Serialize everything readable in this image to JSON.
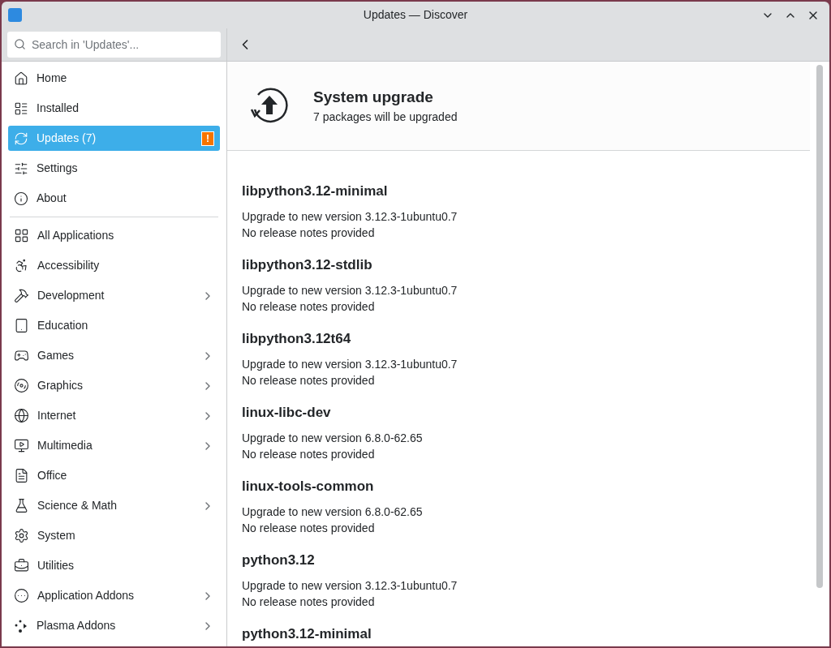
{
  "window": {
    "title": "Updates — Discover"
  },
  "search": {
    "placeholder": "Search in 'Updates'..."
  },
  "sidebar": {
    "items": [
      {
        "label": "Home",
        "selected": false
      },
      {
        "label": "Installed",
        "selected": false
      },
      {
        "label": "Updates (7)",
        "selected": true,
        "badge": "!"
      },
      {
        "label": "Settings",
        "selected": false
      },
      {
        "label": "About",
        "selected": false
      }
    ],
    "categories": [
      {
        "label": "All Applications",
        "expandable": false
      },
      {
        "label": "Accessibility",
        "expandable": false
      },
      {
        "label": "Development",
        "expandable": true
      },
      {
        "label": "Education",
        "expandable": false
      },
      {
        "label": "Games",
        "expandable": true
      },
      {
        "label": "Graphics",
        "expandable": true
      },
      {
        "label": "Internet",
        "expandable": true
      },
      {
        "label": "Multimedia",
        "expandable": true
      },
      {
        "label": "Office",
        "expandable": false
      },
      {
        "label": "Science & Math",
        "expandable": true
      },
      {
        "label": "System",
        "expandable": false
      },
      {
        "label": "Utilities",
        "expandable": false
      },
      {
        "label": "Application Addons",
        "expandable": true
      },
      {
        "label": "Plasma Addons",
        "expandable": true
      }
    ]
  },
  "header": {
    "title": "System upgrade",
    "subtitle": "7 packages will be upgraded"
  },
  "packages": [
    {
      "name": "libpython3.12-minimal",
      "version": "Upgrade to new version 3.12.3-1ubuntu0.7",
      "notes": "No release notes provided"
    },
    {
      "name": "libpython3.12-stdlib",
      "version": "Upgrade to new version 3.12.3-1ubuntu0.7",
      "notes": "No release notes provided"
    },
    {
      "name": "libpython3.12t64",
      "version": "Upgrade to new version 3.12.3-1ubuntu0.7",
      "notes": "No release notes provided"
    },
    {
      "name": "linux-libc-dev",
      "version": "Upgrade to new version 6.8.0-62.65",
      "notes": "No release notes provided"
    },
    {
      "name": "linux-tools-common",
      "version": "Upgrade to new version 6.8.0-62.65",
      "notes": "No release notes provided"
    },
    {
      "name": "python3.12",
      "version": "Upgrade to new version 3.12.3-1ubuntu0.7",
      "notes": "No release notes provided"
    },
    {
      "name": "python3.12-minimal"
    }
  ]
}
